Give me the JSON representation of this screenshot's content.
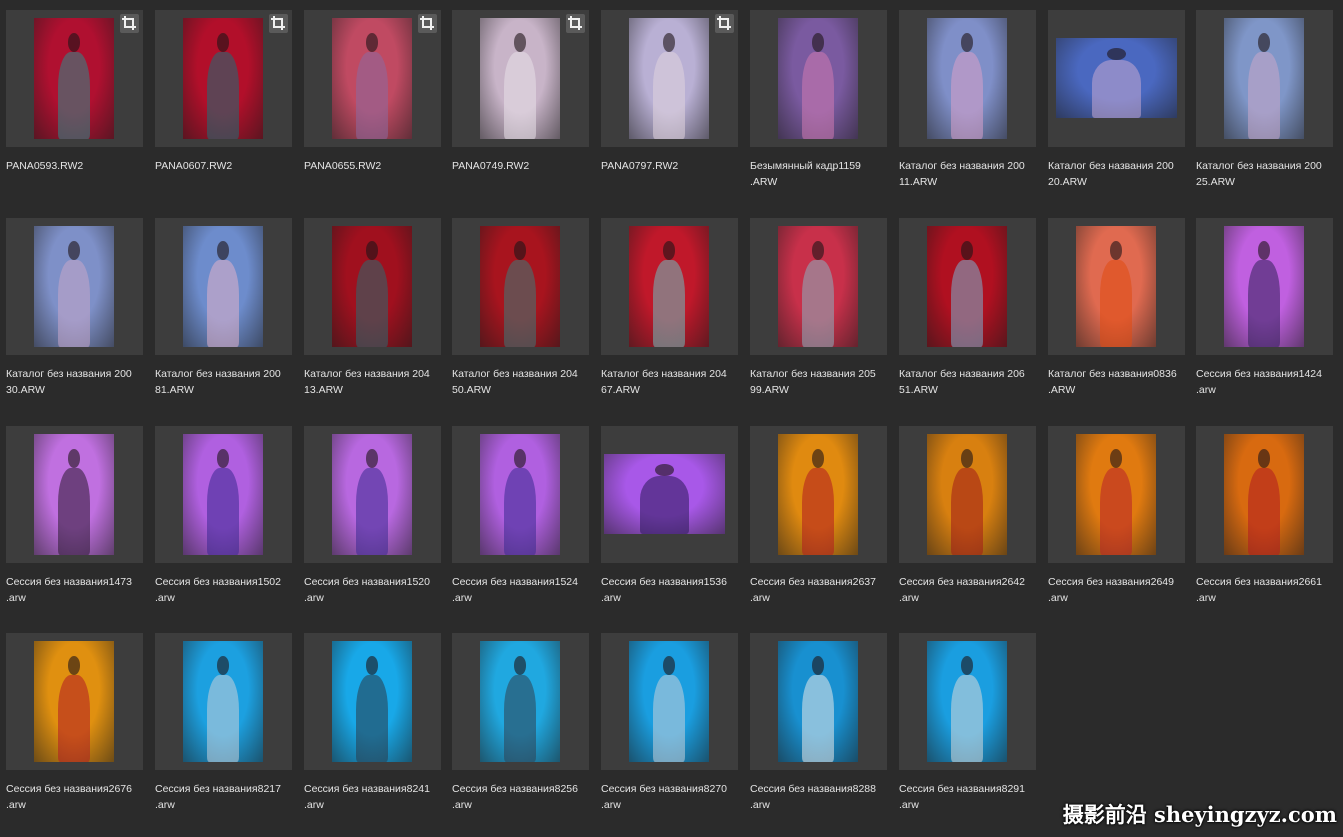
{
  "items": [
    {
      "name": "PANA0593.RW2",
      "cropped": true,
      "bg": "#b01030",
      "fig": "#2e8a8a"
    },
    {
      "name": "PANA0607.RW2",
      "cropped": true,
      "bg": "#b20f2a",
      "fig": "#1b6f76"
    },
    {
      "name": "PANA0655.RW2",
      "cropped": true,
      "bg": "#c04a62",
      "fig": "#8a6aa0"
    },
    {
      "name": "PANA0749.RW2",
      "cropped": true,
      "bg": "#c8b4c8",
      "fig": "#e8e0e8"
    },
    {
      "name": "PANA0797.RW2",
      "cropped": true,
      "bg": "#b9b0d4",
      "fig": "#e0d4dc"
    },
    {
      "name": "Безымянный кадр1159\n.ARW",
      "cropped": false,
      "bg": "#7a5aa0",
      "fig": "#d07ab0"
    },
    {
      "name": "Каталог без названия 200\n11.ARW",
      "cropped": false,
      "bg": "#7f8fc8",
      "fig": "#d8a0c8"
    },
    {
      "name": "Каталог без названия 200\n20.ARW",
      "cropped": false,
      "bg": "#4a68c0",
      "fig": "#c4a8d0"
    },
    {
      "name": "Каталог без названия 200\n25.ARW",
      "cropped": false,
      "bg": "#7f96c8",
      "fig": "#c8a8c8"
    },
    {
      "name": "Каталог без названия 200\n30.ARW",
      "cropped": false,
      "bg": "#7e90c8",
      "fig": "#c4a6c8"
    },
    {
      "name": "Каталог без названия 200\n81.ARW",
      "cropped": false,
      "bg": "#6d8ccc",
      "fig": "#e0b0c8"
    },
    {
      "name": "Каталог без названия 204\n13.ARW",
      "cropped": false,
      "bg": "#a0101e",
      "fig": "#2a6a70"
    },
    {
      "name": "Каталог без названия 204\n50.ARW",
      "cropped": false,
      "bg": "#a8141e",
      "fig": "#3a7a78"
    },
    {
      "name": "Каталог без названия 204\n67.ARW",
      "cropped": false,
      "bg": "#c0182a",
      "fig": "#6ac0c0"
    },
    {
      "name": "Каталог без названия 205\n99.ARW",
      "cropped": false,
      "bg": "#c8304a",
      "fig": "#8ab0c0"
    },
    {
      "name": "Каталог без названия 206\n51.ARW",
      "cropped": false,
      "bg": "#b01020",
      "fig": "#7ab0d0"
    },
    {
      "name": "Каталог без названия0836\n.ARW",
      "cropped": false,
      "bg": "#e06a50",
      "fig": "#e04a10"
    },
    {
      "name": "Сессия без названия1424\n.arw",
      "cropped": false,
      "bg": "#c060e0",
      "fig": "#302058"
    },
    {
      "name": "Сессия без названия1473\n.arw",
      "cropped": false,
      "bg": "#c070e0",
      "fig": "#2a1a30"
    },
    {
      "name": "Сессия без названия1502\n.arw",
      "cropped": false,
      "bg": "#b060e0",
      "fig": "#3a2890"
    },
    {
      "name": "Сессия без названия1520\n.arw",
      "cropped": false,
      "bg": "#b868e0",
      "fig": "#3a2a90"
    },
    {
      "name": "Сессия без названия1524\n.arw",
      "cropped": false,
      "bg": "#b060e0",
      "fig": "#3a2a90"
    },
    {
      "name": "Сессия без названия1536\n.arw",
      "cropped": false,
      "bg": "#a858e8",
      "fig": "#2a1a58"
    },
    {
      "name": "Сессия без названия2637\n.arw",
      "cropped": false,
      "bg": "#e08a10",
      "fig": "#b01a20"
    },
    {
      "name": "Сессия без названия2642\n.arw",
      "cropped": false,
      "bg": "#d88010",
      "fig": "#a01a1a"
    },
    {
      "name": "Сессия без названия2649\n.arw",
      "cropped": false,
      "bg": "#e07a10",
      "fig": "#b8202a"
    },
    {
      "name": "Сессия без названия2661\n.arw",
      "cropped": false,
      "bg": "#d86a10",
      "fig": "#b01a20"
    },
    {
      "name": "Сессия без названия2676\n.arw",
      "cropped": false,
      "bg": "#e09010",
      "fig": "#b01a24"
    },
    {
      "name": "Сессия без названия8217\n.arw",
      "cropped": false,
      "bg": "#1ca0e0",
      "fig": "#c8d0d8"
    },
    {
      "name": "Сессия без названия8241\n.arw",
      "cropped": false,
      "bg": "#18a8e8",
      "fig": "#2a3a48"
    },
    {
      "name": "Сессия без названия8256\n.arw",
      "cropped": false,
      "bg": "#20a8e0",
      "fig": "#304050"
    },
    {
      "name": "Сессия без названия8270\n.arw",
      "cropped": false,
      "bg": "#1a9ee0",
      "fig": "#c8d0d8"
    },
    {
      "name": "Сессия без названия8288\n.arw",
      "cropped": false,
      "bg": "#1890d0",
      "fig": "#e8e8e8"
    },
    {
      "name": "Сессия без названия8291\n.arw",
      "cropped": false,
      "bg": "#1a9ee0",
      "fig": "#d8d8d8"
    }
  ],
  "watermark": "摄影前沿 sheyingzyz.com"
}
